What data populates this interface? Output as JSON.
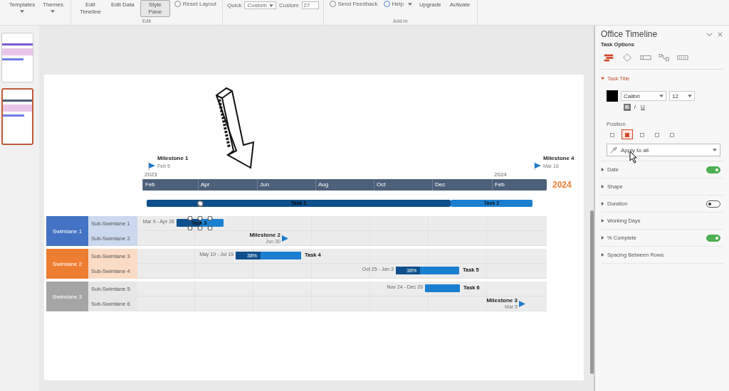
{
  "ribbon": {
    "groups": [
      {
        "items": [
          {
            "kind": "menu",
            "label": "Templates"
          },
          {
            "kind": "menu",
            "label": "Themes"
          }
        ]
      },
      {
        "label": "Edit",
        "items": [
          {
            "kind": "big",
            "label": "Edit Timeline",
            "selected": false
          },
          {
            "kind": "big",
            "label": "Edit Data",
            "selected": false
          },
          {
            "kind": "big",
            "label": "Style Pane",
            "selected": true
          },
          {
            "kind": "radio",
            "label": "Reset Layout"
          }
        ]
      },
      {
        "items": [
          {
            "kind": "dropdown",
            "label": "Quick",
            "value": "Custom"
          },
          {
            "kind": "field",
            "label": "Custom",
            "value": "27"
          }
        ]
      },
      {
        "label": "Add-In",
        "items": [
          {
            "kind": "feedback",
            "label": "Send Feedback"
          },
          {
            "kind": "help",
            "label": "Help"
          },
          {
            "kind": "big",
            "label": "Upgrade",
            "selected": false
          },
          {
            "kind": "big",
            "label": "Activate",
            "selected": false
          }
        ]
      }
    ]
  },
  "thumbnails": [
    {
      "selected": false
    },
    {
      "selected": true
    }
  ],
  "slide": {
    "milestones_top": [
      {
        "title": "Milestone 1",
        "date": "Feb 5"
      },
      {
        "title": "Milestone 4",
        "date": "Mar 16"
      }
    ],
    "years": [
      "2023",
      "2024"
    ],
    "months": [
      "Feb",
      "Apr",
      "Jun",
      "Aug",
      "Oct",
      "Dec",
      "Feb"
    ],
    "current_year": "2024",
    "timeline_tasks": [
      {
        "title": "Task 1"
      },
      {
        "title": "Task 2"
      }
    ],
    "swimlanes": [
      {
        "name": "Swimlane 1",
        "color": "#4472c4",
        "sub_swimlanes": [
          {
            "name": "Sub-Swimlane 1",
            "item": {
              "kind": "task",
              "dates": "Mar 9 - Apr 26",
              "title": "Task 3",
              "selected": true
            }
          },
          {
            "name": "Sub-Swimlane 2",
            "item": {
              "kind": "milestone",
              "title": "Milestone 2",
              "date": "Jun 30"
            }
          }
        ]
      },
      {
        "name": "Swimlane 2",
        "color": "#ed7d31",
        "sub_swimlanes": [
          {
            "name": "Sub-Swimlane 3",
            "item": {
              "kind": "task",
              "dates": "May 10 - Jul 19",
              "title": "Task 4",
              "percent": "38%",
              "level": 0.38,
              "selected": false
            }
          },
          {
            "name": "Sub-Swimlane 4",
            "item": {
              "kind": "task",
              "dates": "Oct 25 - Jan 3",
              "title": "Task 5",
              "percent": "38%",
              "level": 0.38,
              "selected": false
            }
          }
        ]
      },
      {
        "name": "Swimlane 3",
        "color": "#a5a5a5",
        "sub_swimlanes": [
          {
            "name": "Sub-Swimlane 5",
            "item": {
              "kind": "task",
              "dates": "Nov 24 - Dec 29",
              "title": "Task 6",
              "selected": false
            }
          },
          {
            "name": "Sub-Swimlane 6",
            "item": {
              "kind": "milestone",
              "title": "Milestone 3",
              "date": "Mar 5"
            }
          }
        ]
      }
    ]
  },
  "pane": {
    "title": "Office Timeline",
    "subtitle": "Task Options",
    "tabs": [
      {
        "selected": true
      },
      {
        "selected": false
      },
      {
        "selected": false
      },
      {
        "selected": false
      },
      {
        "selected": false
      }
    ],
    "section": {
      "title": "Task Title",
      "expanded": true,
      "font": "Calibri",
      "size": "12",
      "formats": [
        {
          "label": "B",
          "selected": true
        },
        {
          "label": "I",
          "selected": false
        },
        {
          "label": "U",
          "selected": false
        }
      ],
      "position_label": "Position",
      "positions": [
        {
          "selected": false
        },
        {
          "selected": true
        },
        {
          "selected": false
        },
        {
          "selected": false
        },
        {
          "selected": false
        }
      ],
      "apply": "Apply to all"
    },
    "options": [
      {
        "kind": "toggle",
        "label": "Date",
        "on": true,
        "expanded": false
      },
      {
        "kind": "plain",
        "label": "Shape",
        "expanded": false
      },
      {
        "kind": "toggle",
        "label": "Duration",
        "on": false,
        "expanded": false
      },
      {
        "kind": "plain",
        "label": "Working Days",
        "expanded": false
      },
      {
        "kind": "toggle",
        "label": "% Complete",
        "on": true,
        "expanded": false
      },
      {
        "kind": "plain",
        "label": "Spacing Between Rows",
        "expanded": false
      }
    ]
  }
}
